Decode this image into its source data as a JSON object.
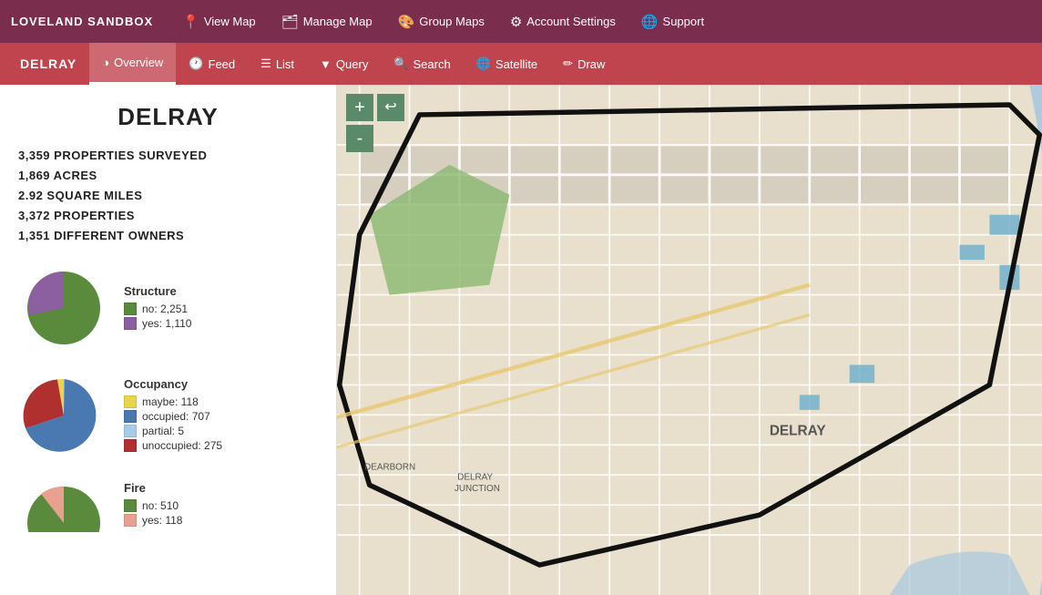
{
  "brand": "LOVELAND SANDBOX",
  "top_nav": {
    "items": [
      {
        "label": "View Map",
        "icon": "📍"
      },
      {
        "label": "Manage Map",
        "icon": "🗂"
      },
      {
        "label": "Group Maps",
        "icon": "🎨"
      },
      {
        "label": "Account Settings",
        "icon": "⚙"
      },
      {
        "label": "Support",
        "icon": "🌐"
      }
    ]
  },
  "sub_nav": {
    "brand": "DELRAY",
    "items": [
      {
        "label": "Overview",
        "icon": "◑",
        "active": true
      },
      {
        "label": "Feed",
        "icon": "🕐"
      },
      {
        "label": "List",
        "icon": "☰"
      },
      {
        "label": "Query",
        "icon": "🔺"
      },
      {
        "label": "Search",
        "icon": "🔍"
      },
      {
        "label": "Satellite",
        "icon": "🌐"
      },
      {
        "label": "Draw",
        "icon": "✏"
      }
    ]
  },
  "overview": {
    "title": "DELRAY",
    "stats": [
      "3,359 PROPERTIES SURVEYED",
      "1,869 ACRES",
      "2.92 SQUARE MILES",
      "3,372 PROPERTIES",
      "1,351 DIFFERENT OWNERS"
    ],
    "charts": [
      {
        "title": "Structure",
        "segments": [
          {
            "label": "no",
            "value": 2251,
            "color": "#5a8a3c",
            "percent": 66
          },
          {
            "label": "yes",
            "value": 1110,
            "color": "#8b5fa0",
            "percent": 34
          }
        ],
        "legend": [
          {
            "label": "no: 2,251",
            "color": "#5a8a3c"
          },
          {
            "label": "yes: 1,110",
            "color": "#8b5fa0"
          }
        ]
      },
      {
        "title": "Occupancy",
        "segments": [
          {
            "label": "maybe",
            "value": 118,
            "color": "#e8d44d",
            "percent": 10
          },
          {
            "label": "occupied",
            "value": 707,
            "color": "#4a78b0",
            "percent": 63
          },
          {
            "label": "partial",
            "value": 5,
            "color": "#a8cce8",
            "percent": 1
          },
          {
            "label": "unoccupied",
            "value": 275,
            "color": "#b03030",
            "percent": 26
          }
        ],
        "legend": [
          {
            "label": "maybe: 118",
            "color": "#e8d44d"
          },
          {
            "label": "occupied: 707",
            "color": "#4a78b0"
          },
          {
            "label": "partial: 5",
            "color": "#a8cce8"
          },
          {
            "label": "unoccupied: 275",
            "color": "#b03030"
          }
        ]
      },
      {
        "title": "Fire",
        "segments": [
          {
            "label": "no",
            "value": 510,
            "color": "#5a8a3c",
            "percent": 81
          },
          {
            "label": "yes",
            "value": 118,
            "color": "#e8a090",
            "percent": 19
          }
        ],
        "legend": [
          {
            "label": "no: 510",
            "color": "#5a8a3c"
          },
          {
            "label": "yes: 118",
            "color": "#e8a090"
          }
        ]
      }
    ]
  },
  "map_controls": {
    "zoom_in": "+",
    "zoom_out": "-",
    "undo": "↩"
  }
}
